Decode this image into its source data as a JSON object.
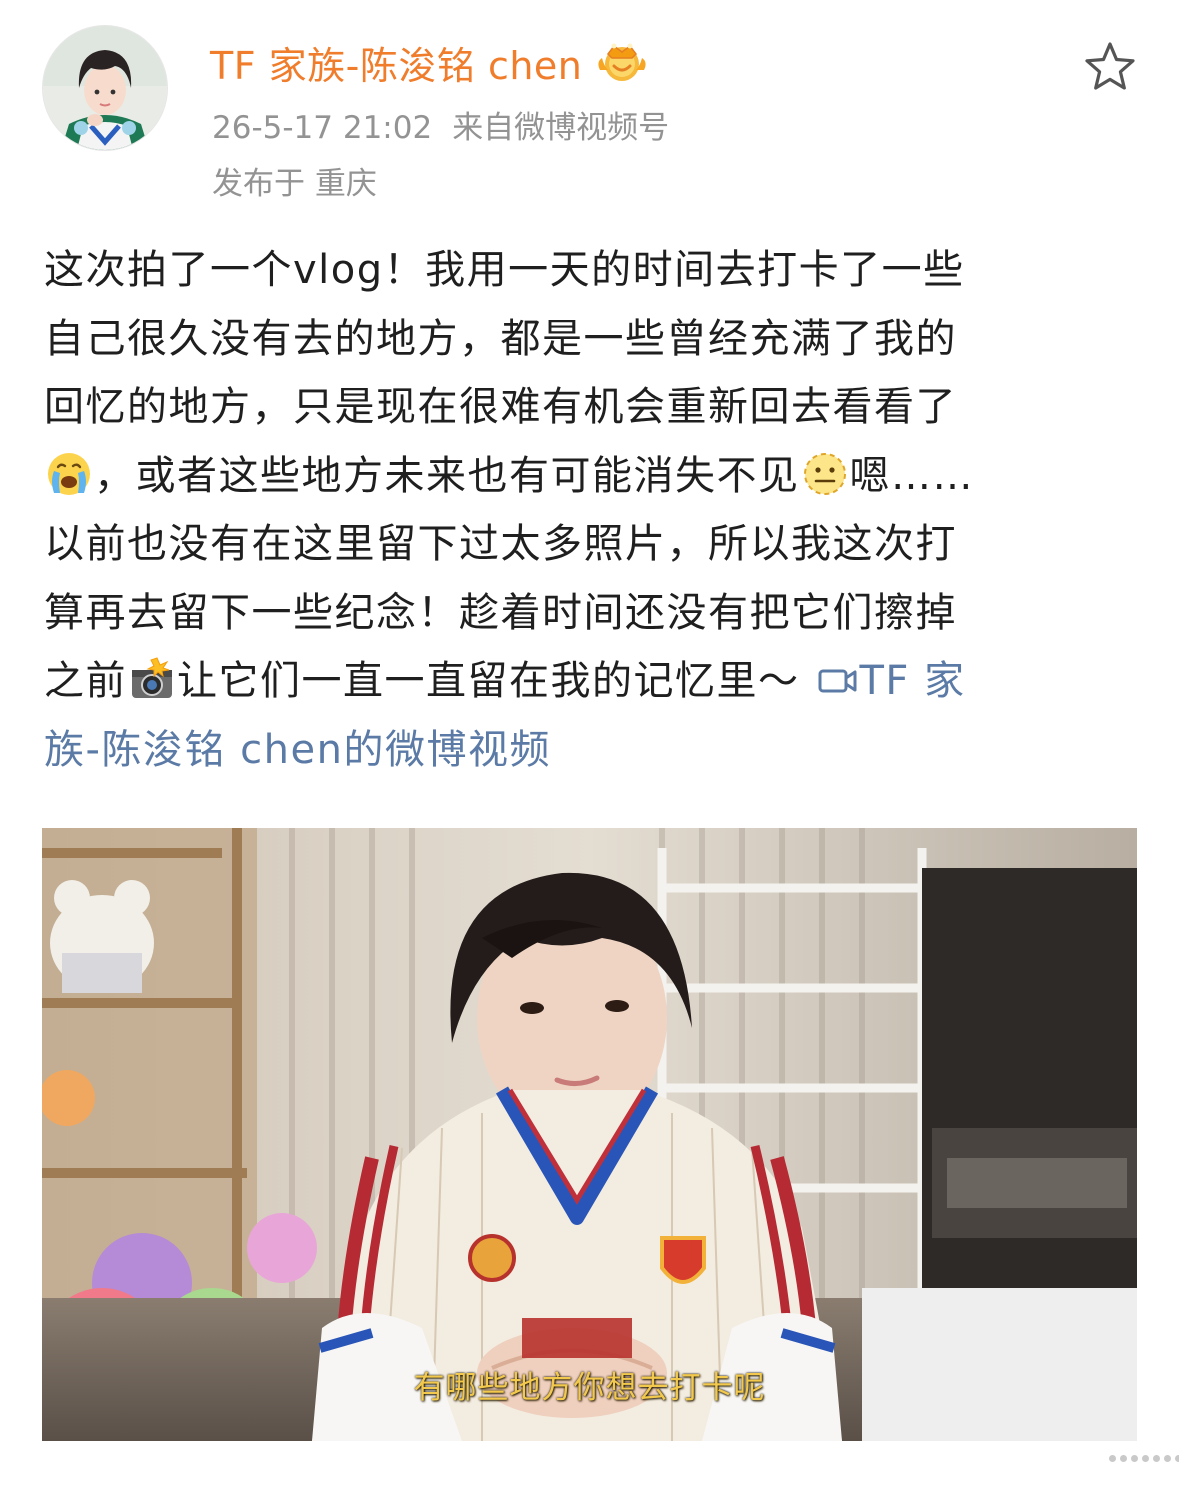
{
  "post": {
    "author": {
      "username": "TF 家族-陈浚铭 chen",
      "badge_icon": "crown-badge-icon",
      "avatar_icon": "avatar-icon"
    },
    "timestamp": "26-5-17 21:02",
    "source": "来自微博视频号",
    "location": "发布于 重庆",
    "favorite_icon": "star-outline-icon",
    "content": {
      "line1": "这次拍了一个vlog！我用一天的时间去打卡了一些",
      "line2": "自己很久没有去的地方，都是一些曾经充满了我的",
      "line3": "回忆的地方，只是现在很难有机会重新回去看看了",
      "line4_text": "，或者这些地方未来也有可能消失不见",
      "line4_end": "嗯……",
      "line5": "以前也没有在这里留下过太多照片，所以我这次打",
      "line6": "算再去留下一些纪念！趁着时间还没有把它们擦掉",
      "line7_start": "之前",
      "line7_text": "让它们一直一直留在我的记忆里～",
      "video_link_part1": "TF 家",
      "video_link_part2": "族-陈浚铭 chen的微博视频",
      "emojis": [
        "crying-face-emoji",
        "neutral-face-emoji",
        "camera-flash-emoji"
      ],
      "video_link_icon": "video-icon"
    },
    "video": {
      "subtitle": "有哪些地方你想去打卡呢"
    }
  },
  "colors": {
    "username": "#f07d2c",
    "meta": "#939393",
    "link": "#5b7ba6",
    "text": "#1f1f1f",
    "subtitle": "#f2c94c"
  }
}
